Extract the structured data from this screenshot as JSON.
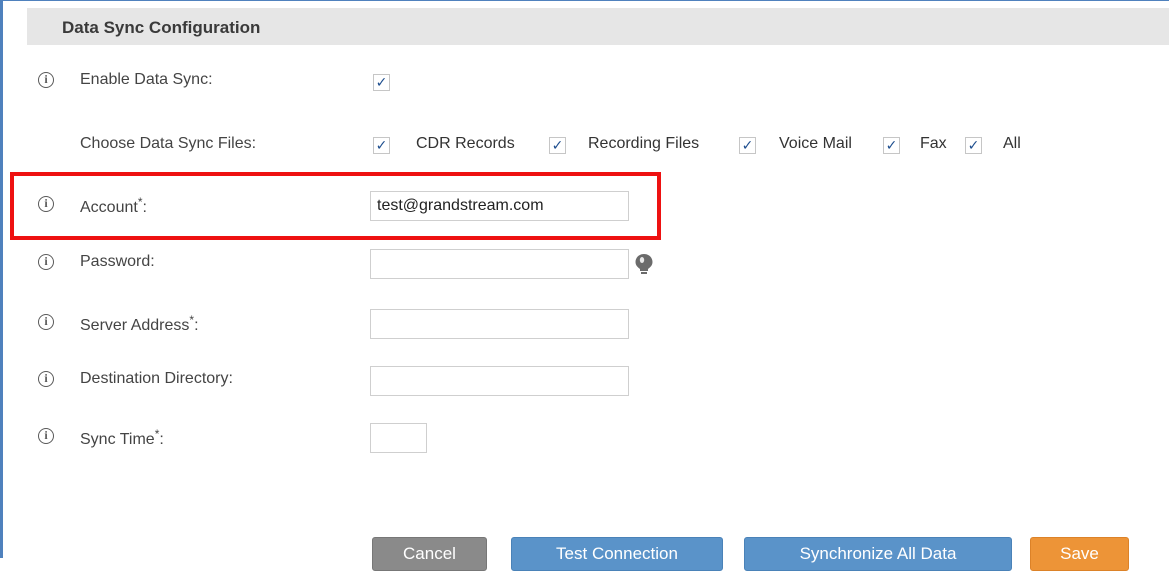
{
  "section": {
    "title": "Data Sync Configuration"
  },
  "fields": {
    "enable_sync": {
      "label": "Enable Data Sync:",
      "checked": true
    },
    "choose_files": {
      "label": "Choose Data Sync Files:",
      "options": [
        {
          "label": "CDR Records",
          "checked": true
        },
        {
          "label": "Recording Files",
          "checked": true
        },
        {
          "label": "Voice Mail",
          "checked": true
        },
        {
          "label": "Fax",
          "checked": true
        },
        {
          "label": "All",
          "checked": true
        }
      ]
    },
    "account": {
      "label": "Account",
      "required_mark": "*",
      "suffix": ":",
      "value": "test@grandstream.com"
    },
    "password": {
      "label": "Password:",
      "value": ""
    },
    "server_address": {
      "label": "Server Address",
      "required_mark": "*",
      "suffix": ":",
      "value": ""
    },
    "destination_directory": {
      "label": "Destination Directory:",
      "value": ""
    },
    "sync_time": {
      "label": "Sync Time",
      "required_mark": "*",
      "suffix": ":",
      "value": ""
    }
  },
  "icons": {
    "info": "info-icon",
    "password_hint": "lightbulb-icon",
    "check": "checkmark-icon"
  },
  "buttons": {
    "cancel": "Cancel",
    "test_connection": "Test Connection",
    "synchronize_all": "Synchronize All Data",
    "save": "Save"
  },
  "colors": {
    "frame_border": "#4f81bd",
    "highlight": "#ee1111",
    "button_primary": "#5a93c9",
    "button_cancel": "#8a8a8a",
    "button_save": "#ed9437"
  }
}
